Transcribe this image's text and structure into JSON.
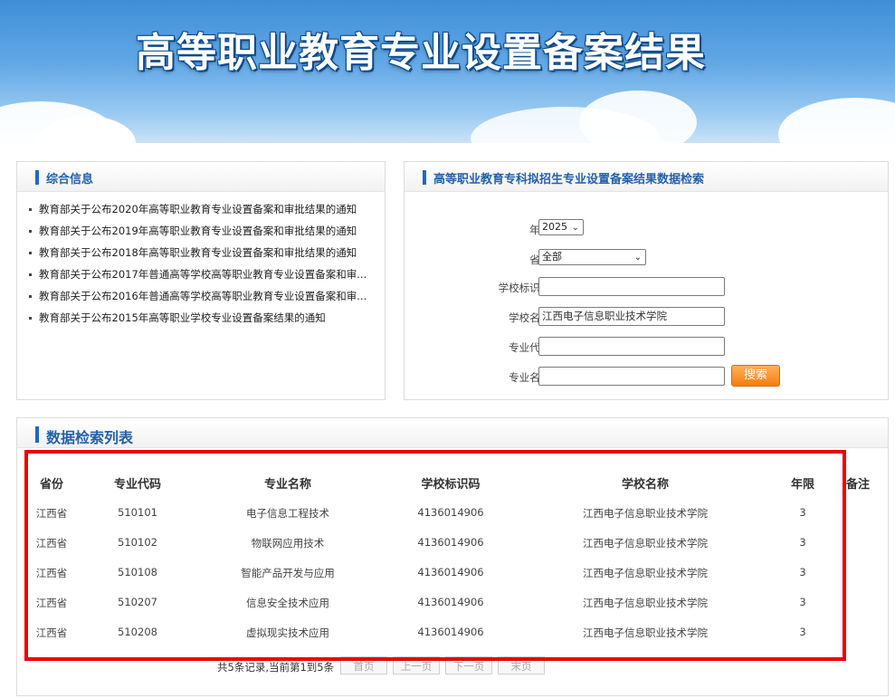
{
  "header": {
    "title": "高等职业教育专业设置备案结果"
  },
  "news": {
    "title": "综合信息",
    "items": [
      "教育部关于公布2020年高等职业教育专业设置备案和审批结果的通知",
      "教育部关于公布2019年高等职业教育专业设置备案和审批结果的通知",
      "教育部关于公布2018年高等职业教育专业设置备案和审批结果的通知",
      "教育部关于公布2017年普通高等学校高等职业教育专业设置备案和审...",
      "教育部关于公布2016年普通高等学校高等职业教育专业设置备案和审...",
      "教育部关于公布2015年高等职业学校专业设置备案结果的通知"
    ]
  },
  "search": {
    "title": "高等职业教育专科拟招生专业设置备案结果数据检索",
    "year_label": "年份:",
    "year_value": "2025",
    "province_label": "省份:",
    "province_value": "全部",
    "school_code_label": "学校标识码:",
    "school_code_value": "",
    "school_name_label": "学校名称:",
    "school_name_value": "江西电子信息职业技术学院",
    "major_code_label": "专业代码:",
    "major_code_value": "",
    "major_name_label": "专业名称:",
    "major_name_value": "",
    "button_label": "搜索"
  },
  "results": {
    "title": "数据检索列表",
    "columns": [
      "省份",
      "专业代码",
      "专业名称",
      "学校标识码",
      "学校名称",
      "年限",
      "备注"
    ],
    "rows": [
      [
        "江西省",
        "510101",
        "电子信息工程技术",
        "4136014906",
        "江西电子信息职业技术学院",
        "3",
        ""
      ],
      [
        "江西省",
        "510102",
        "物联网应用技术",
        "4136014906",
        "江西电子信息职业技术学院",
        "3",
        ""
      ],
      [
        "江西省",
        "510108",
        "智能产品开发与应用",
        "4136014906",
        "江西电子信息职业技术学院",
        "3",
        ""
      ],
      [
        "江西省",
        "510207",
        "信息安全技术应用",
        "4136014906",
        "江西电子信息职业技术学院",
        "3",
        ""
      ],
      [
        "江西省",
        "510208",
        "虚拟现实技术应用",
        "4136014906",
        "江西电子信息职业技术学院",
        "3",
        ""
      ]
    ]
  },
  "pager": {
    "info": "共5条记录,当前第1到5条",
    "first": "首页",
    "prev": "上一页",
    "next": "下一页",
    "last": "末页"
  },
  "colors": {
    "accent": "#2361ad",
    "button": "#f47d10",
    "highlight": "#ee0000"
  }
}
